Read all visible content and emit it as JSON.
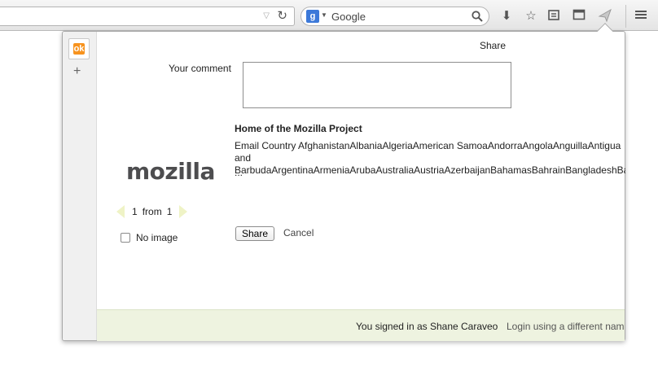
{
  "toolbar": {
    "search_placeholder": "Google",
    "search_engine_letter": "g"
  },
  "panel": {
    "title": "Share",
    "comment_label": "Your comment",
    "comment_value": "",
    "link_title": "Home of the Mozilla Project",
    "link_description": "Email Country AfghanistanAlbaniaAlgeriaAmerican SamoaAndorraAngolaAnguillaAntigua and BarbudaArgentinaArmeniaArubaAustraliaAustriaAzerbaijanBahamasBahrainBangladeshBa",
    "link_ellipsis": "...",
    "logo_text": "mozilla",
    "pager": {
      "current": "1",
      "word": "from",
      "total": "1"
    },
    "no_image_label": "No image",
    "share_button": "Share",
    "cancel_link": "Cancel",
    "signed_in_text": "You signed in as Shane Caraveo",
    "login_different": "Login using a different name"
  },
  "colors": {
    "footer_bg": "#eef3e0",
    "provider_accent": "#f7931e",
    "search_engine": "#3c79d9"
  }
}
